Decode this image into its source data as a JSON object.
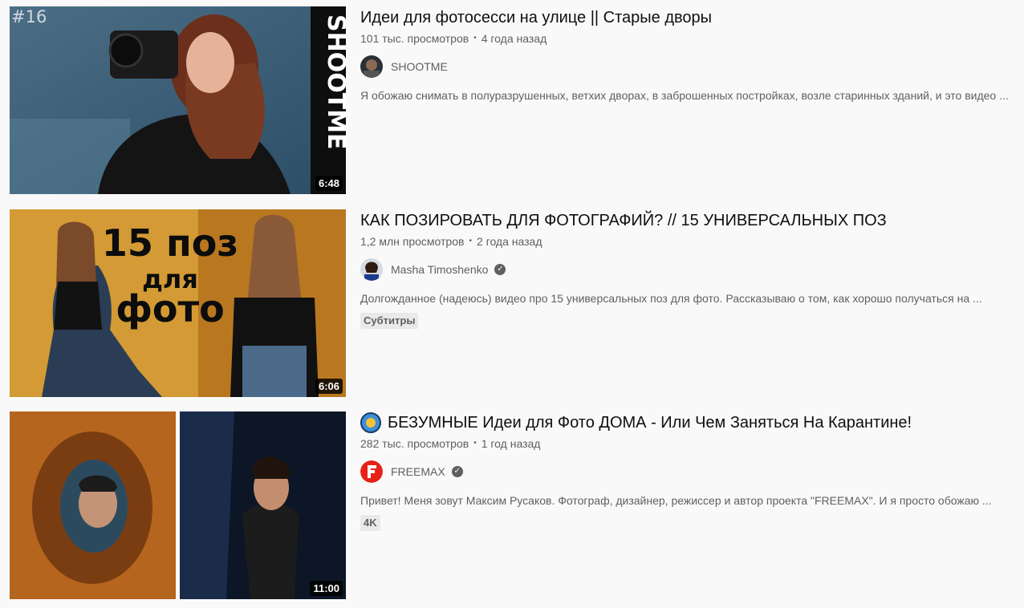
{
  "videos": [
    {
      "episode": "#16",
      "title": "Идеи для фотосесси на улице || Старые дворы",
      "views": "101 тыс. просмотров",
      "age": "4 года назад",
      "channel": "SHOOTME",
      "verified": false,
      "description": "Я обожаю снимать в полуразрушенных, ветхих дворах, в заброшенных постройках, возле старинных зданий, и это видео ...",
      "duration": "6:48",
      "thumb_side_text": "SHOOTME"
    },
    {
      "title": "КАК ПОЗИРОВАТЬ ДЛЯ ФОТОГРАФИЙ? // 15 УНИВЕРСАЛЬНЫХ ПОЗ",
      "views": "1,2 млн просмотров",
      "age": "2 года назад",
      "channel": "Masha Timoshenko",
      "verified": true,
      "description": "Долгожданное (надеюсь) видео про 15 универсальных поз для фото. Рассказываю о том, как хорошо получаться на ...",
      "badge": "Субтитры",
      "duration": "6:06",
      "thumb_text": [
        "15 поз",
        "для",
        "фото"
      ]
    },
    {
      "title": "БЕЗУМНЫЕ Идеи для Фото ДОМА - Или Чем Заняться На Карантине!",
      "views": "282 тыс. просмотров",
      "age": "1 год назад",
      "channel": "FREEMAX",
      "verified": true,
      "description": "Привет! Меня зовут Максим Русаков. Фотограф, дизайнер, режиссер и автор проекта \"FREEMAX\". И я просто обожаю ...",
      "badge": "4K",
      "duration": "11:00"
    }
  ],
  "icons": {
    "verified": "verified-check-icon",
    "title_emoji": "lion-emoji-icon"
  },
  "colors": {
    "background": "#f9f9f9",
    "text_primary": "#0f0f0f",
    "text_secondary": "#606060",
    "freemax_red": "#e62117"
  }
}
